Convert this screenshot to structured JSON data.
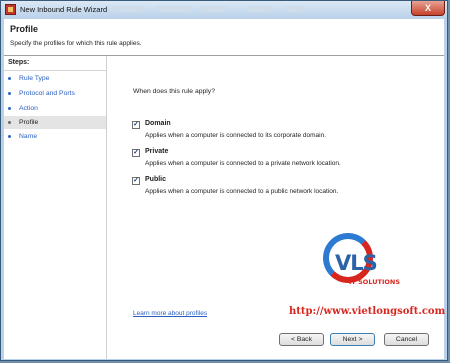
{
  "window": {
    "title": "New Inbound Rule Wizard",
    "close_glyph": "X"
  },
  "header": {
    "title": "Profile",
    "subtitle": "Specify the profiles for which this rule applies."
  },
  "steps": {
    "label": "Steps:",
    "items": [
      {
        "label": "Rule Type",
        "active": false
      },
      {
        "label": "Protocol and Ports",
        "active": false
      },
      {
        "label": "Action",
        "active": false
      },
      {
        "label": "Profile",
        "active": true
      },
      {
        "label": "Name",
        "active": false
      }
    ]
  },
  "content": {
    "question": "When does this rule apply?",
    "options": [
      {
        "name": "Domain",
        "checked": true,
        "description": "Applies when a computer is connected to its corporate domain."
      },
      {
        "name": "Private",
        "checked": true,
        "description": "Applies when a computer is connected to a private network location."
      },
      {
        "name": "Public",
        "checked": true,
        "description": "Applies when a computer is connected to a public network location."
      }
    ],
    "learn_more": "Learn more about profiles"
  },
  "watermark": {
    "logo_text": "VLS",
    "tagline": "IT SOLUTIONS",
    "url": "http://www.vietlongsoft.com",
    "colors": {
      "blue": "#2b62a8",
      "red": "#d7261e"
    }
  },
  "buttons": {
    "back": "< Back",
    "next": "Next >",
    "cancel": "Cancel"
  },
  "colors": {
    "titlebar": "#b9d1ea",
    "link": "#2a5fbf",
    "close_button": "#c7422c"
  },
  "icons": {
    "app_icon": "firewall-icon",
    "step_bullet": "bullet-icon",
    "checkmark": "checkmark-icon"
  }
}
